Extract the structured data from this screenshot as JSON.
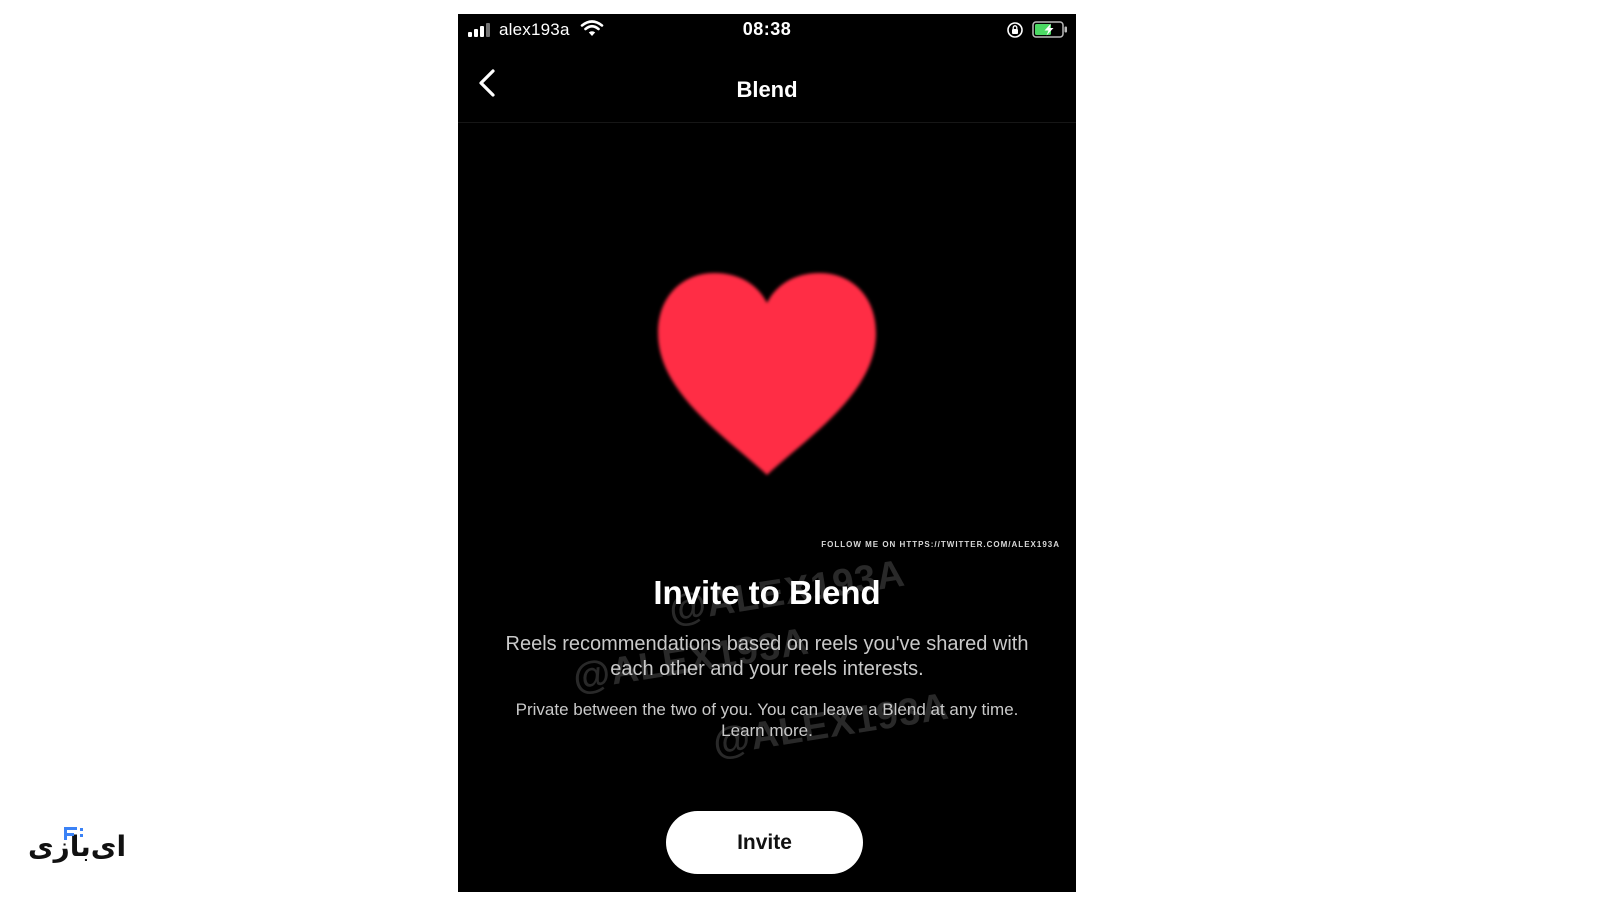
{
  "status_bar": {
    "carrier": "alex193a",
    "time": "08:38"
  },
  "nav": {
    "title": "Blend"
  },
  "hero": {
    "heart_color": "#ff2d45"
  },
  "content": {
    "follow_note": "FOLLOW ME ON HTTPS://TWITTER.COM/ALEX193A",
    "title": "Invite to Blend",
    "description": "Reels recommendations based on reels you've shared with each other and your reels interests.",
    "privacy_text": "Private between the two of you. You can leave a Blend at any time.",
    "learn_more": "Learn more."
  },
  "watermark": {
    "text": "@ALEX193A"
  },
  "actions": {
    "invite_label": "Invite"
  },
  "site_logo": {
    "text": "ای‌بازی"
  },
  "colors": {
    "background": "#000000",
    "battery_charge": "#4cd964",
    "button_bg": "#ffffff"
  }
}
